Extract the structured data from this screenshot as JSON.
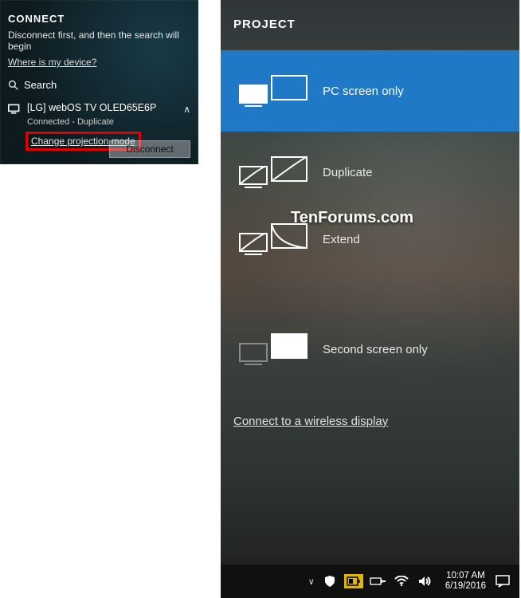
{
  "connect": {
    "title": "CONNECT",
    "subtitle": "Disconnect first, and then the search will begin",
    "where_link": "Where is my device?",
    "search_label": "Search",
    "device": {
      "name": "[LG] webOS TV OLED65E6P",
      "status": "Connected - Duplicate",
      "change_mode": "Change projection mode"
    },
    "disconnect_label": "Disconnect"
  },
  "project": {
    "title": "PROJECT",
    "options": [
      {
        "id": "pc-only",
        "label": "PC screen only",
        "selected": true
      },
      {
        "id": "duplicate",
        "label": "Duplicate",
        "selected": false
      },
      {
        "id": "extend",
        "label": "Extend",
        "selected": false
      },
      {
        "id": "second-only",
        "label": "Second screen only",
        "selected": false
      }
    ],
    "wireless_link": "Connect to a wireless display"
  },
  "watermark": "TenForums.com",
  "taskbar": {
    "time": "10:07 AM",
    "date": "6/19/2016"
  }
}
